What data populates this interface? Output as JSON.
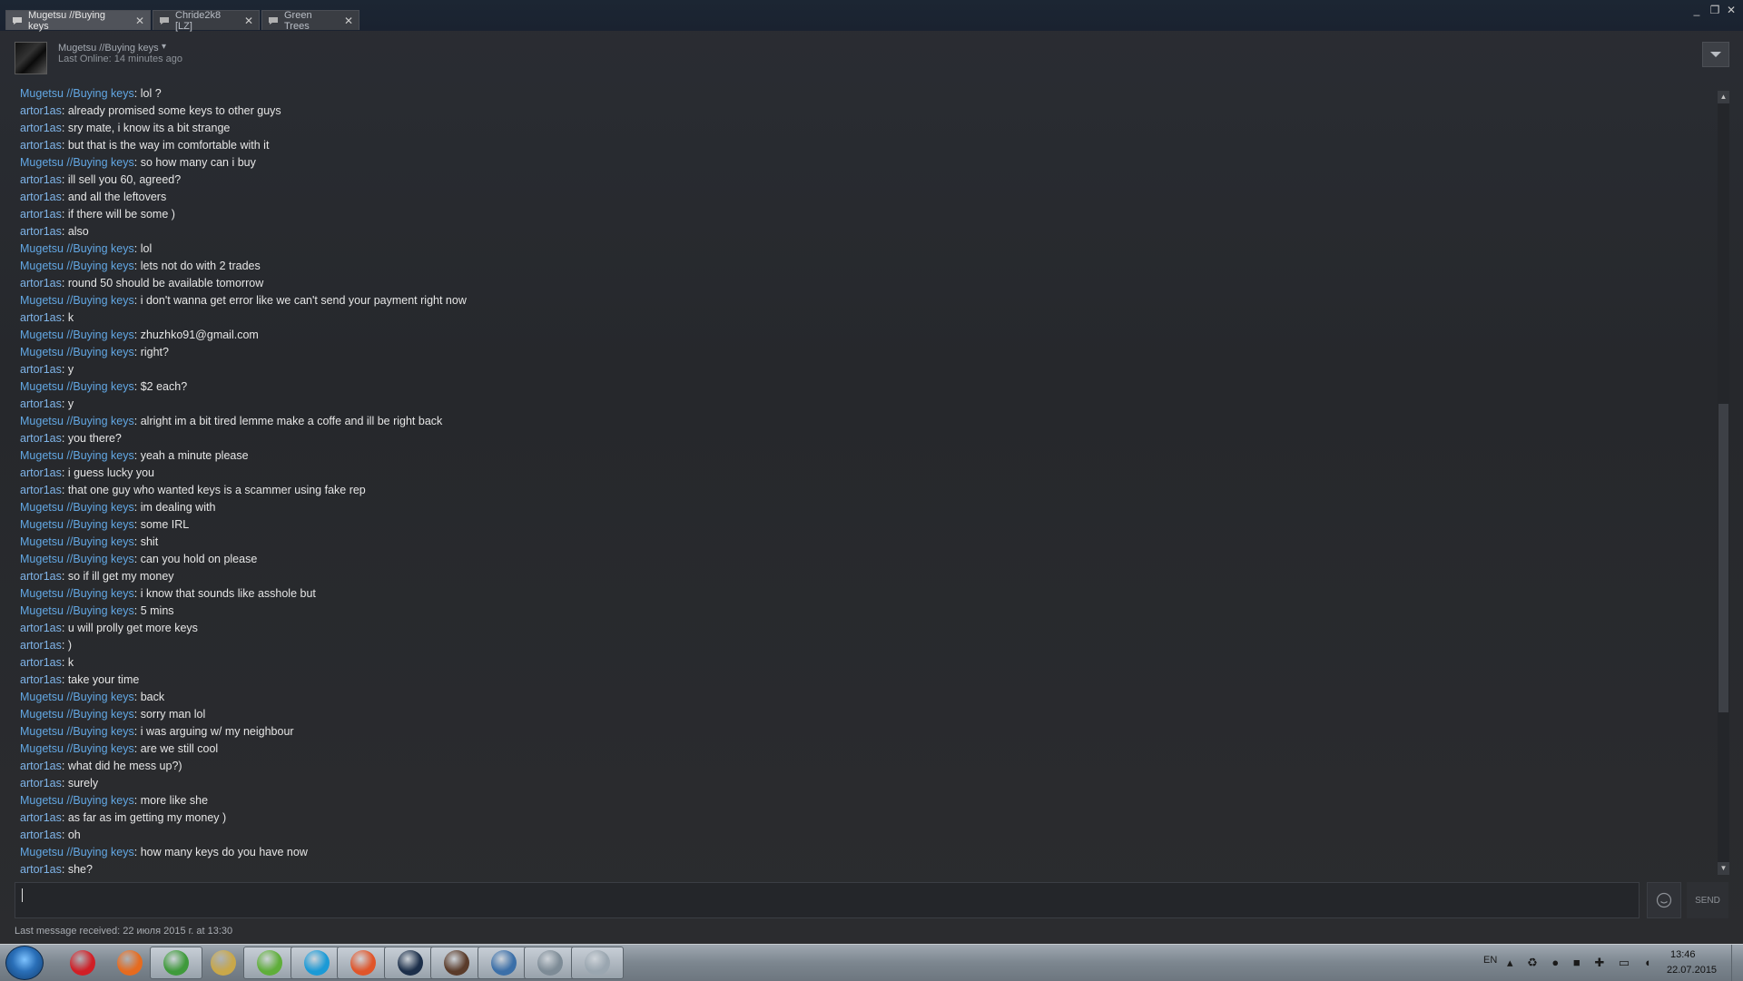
{
  "tabs": [
    {
      "label": "Mugetsu //Buying keys",
      "active": true
    },
    {
      "label": "Chride2k8 [LZ]",
      "active": false
    },
    {
      "label": "Green Trees",
      "active": false
    }
  ],
  "window_controls": {
    "minimize": "_",
    "maximize": "❐",
    "close": "✕"
  },
  "friend": {
    "name": "Mugetsu //Buying keys",
    "status": "Last Online: 14 minutes ago",
    "dropdown": "▾"
  },
  "messages": [
    {
      "sender": "Mugetsu //Buying keys",
      "text": "lol ?"
    },
    {
      "sender": "artor1as",
      "text": "already promised some keys to other guys"
    },
    {
      "sender": "artor1as",
      "text": "sry mate, i know its a bit strange"
    },
    {
      "sender": "artor1as",
      "text": "but that is the way im comfortable with it"
    },
    {
      "sender": "Mugetsu //Buying keys",
      "text": "so how many can i buy"
    },
    {
      "sender": "artor1as",
      "text": "ill sell you 60, agreed?"
    },
    {
      "sender": "artor1as",
      "text": "and all the leftovers"
    },
    {
      "sender": "artor1as",
      "text": "if there will be some )"
    },
    {
      "sender": "artor1as",
      "text": "also"
    },
    {
      "sender": "Mugetsu //Buying keys",
      "text": "lol"
    },
    {
      "sender": "Mugetsu //Buying keys",
      "text": "lets not do with 2 trades"
    },
    {
      "sender": "artor1as",
      "text": "round 50 should be available tomorrow"
    },
    {
      "sender": "Mugetsu //Buying keys",
      "text": "i don't wanna get error like we can't send your payment right now"
    },
    {
      "sender": "artor1as",
      "text": "k"
    },
    {
      "sender": "Mugetsu //Buying keys",
      "text": "zhuzhko91@gmail.com"
    },
    {
      "sender": "Mugetsu //Buying keys",
      "text": "right?"
    },
    {
      "sender": "artor1as",
      "text": "y"
    },
    {
      "sender": "Mugetsu //Buying keys",
      "text": "$2 each?"
    },
    {
      "sender": "artor1as",
      "text": "y"
    },
    {
      "sender": "Mugetsu //Buying keys",
      "text": "alright im a bit tired lemme make a coffe and ill be right back"
    },
    {
      "sender": "artor1as",
      "text": "you there?"
    },
    {
      "sender": "Mugetsu //Buying keys",
      "text": "yeah a minute please"
    },
    {
      "sender": "artor1as",
      "text": "i guess lucky you"
    },
    {
      "sender": "artor1as",
      "text": "that one guy who wanted keys is a scammer using fake rep"
    },
    {
      "sender": "Mugetsu //Buying keys",
      "text": "im dealing with"
    },
    {
      "sender": "Mugetsu //Buying keys",
      "text": "some IRL"
    },
    {
      "sender": "Mugetsu //Buying keys",
      "text": "shit"
    },
    {
      "sender": "Mugetsu //Buying keys",
      "text": "can you hold on please"
    },
    {
      "sender": "artor1as",
      "text": "so if ill get my money"
    },
    {
      "sender": "Mugetsu //Buying keys",
      "text": "i know that sounds like asshole but"
    },
    {
      "sender": "Mugetsu //Buying keys",
      "text": "5 mins"
    },
    {
      "sender": "artor1as",
      "text": "u will prolly get more keys"
    },
    {
      "sender": "artor1as",
      "text": ")"
    },
    {
      "sender": "artor1as",
      "text": "k"
    },
    {
      "sender": "artor1as",
      "text": "take your time"
    },
    {
      "sender": "Mugetsu //Buying keys",
      "text": "back"
    },
    {
      "sender": "Mugetsu //Buying keys",
      "text": "sorry man lol"
    },
    {
      "sender": "Mugetsu //Buying keys",
      "text": "i was arguing w/ my neighbour"
    },
    {
      "sender": "Mugetsu //Buying keys",
      "text": "are we still cool"
    },
    {
      "sender": "artor1as",
      "text": "what did he mess up?)"
    },
    {
      "sender": "artor1as",
      "text": "surely"
    },
    {
      "sender": "Mugetsu //Buying keys",
      "text": "more like she"
    },
    {
      "sender": "artor1as",
      "text": "as far as im getting my money )"
    },
    {
      "sender": "artor1as",
      "text": "oh"
    },
    {
      "sender": "Mugetsu //Buying keys",
      "text": "how many keys do you have now"
    },
    {
      "sender": "artor1as",
      "text": "she?"
    }
  ],
  "input": {
    "value": "",
    "send_label": "SEND"
  },
  "last_message": "Last message received: 22 июля 2015 г. at 13:30",
  "colors": {
    "friend_name": "#62a7e3",
    "self_name": "#7fb4e8",
    "message_text": "#e6e6e6",
    "background": "#2a2d33"
  },
  "taskbar": {
    "apps": [
      "opera-icon",
      "firefox-icon",
      "chrome-icon",
      "explorer-icon",
      "utorrent-icon",
      "skype-icon",
      "media-player-icon",
      "steam-icon",
      "game-icon",
      "app-icon",
      "calculator-icon",
      "paint-icon"
    ],
    "language": "EN",
    "time": "13:46",
    "date": "22.07.2015"
  }
}
